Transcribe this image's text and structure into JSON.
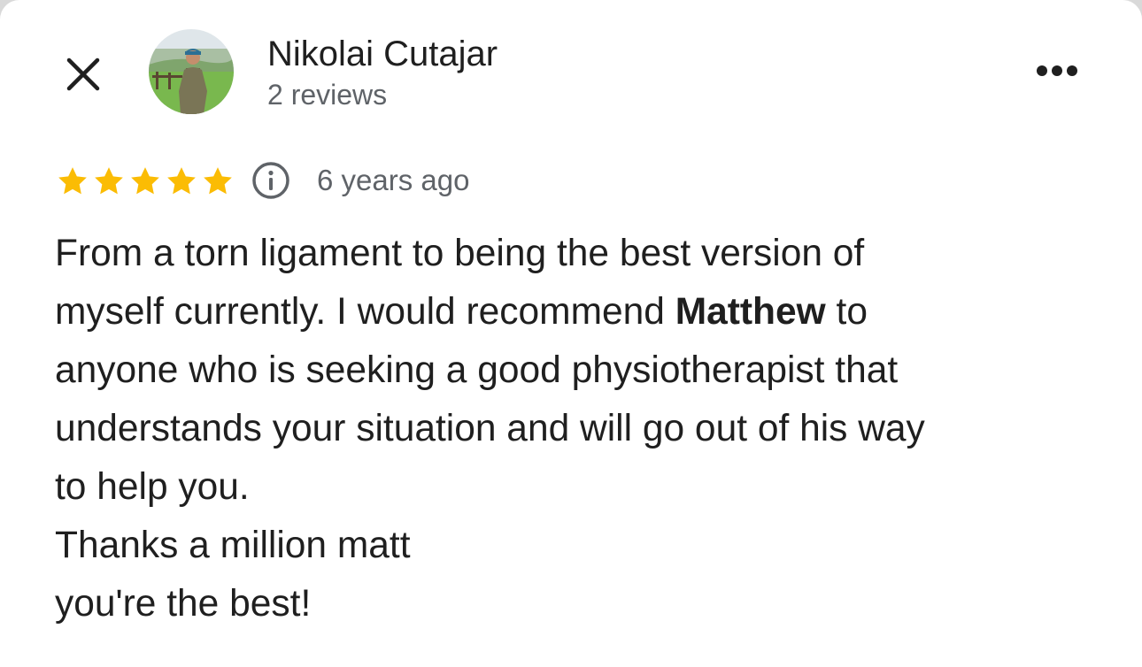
{
  "header": {
    "close_icon": "close-icon",
    "author_name": "Nikolai Cutajar",
    "review_count": "2 reviews",
    "more_icon": "more-horizontal-icon"
  },
  "rating": {
    "stars": 5,
    "max_stars": 5,
    "star_color": "#fbbc04",
    "info_icon": "info-icon",
    "time_ago": "6 years ago"
  },
  "review": {
    "line1": "From a torn ligament to being the best version of",
    "line2_before": "myself currently. I would recommend ",
    "line2_bold": "Matthew",
    "line2_after": " to",
    "line3": "anyone who is seeking a good physiotherapist that",
    "line4": "understands your situation and will go out of his way",
    "line5": "to help you.",
    "line6": "Thanks a million matt",
    "line7": "you're the best!"
  },
  "colors": {
    "text_primary": "#1f1f1f",
    "text_secondary": "#5f6368",
    "background": "#ffffff"
  }
}
